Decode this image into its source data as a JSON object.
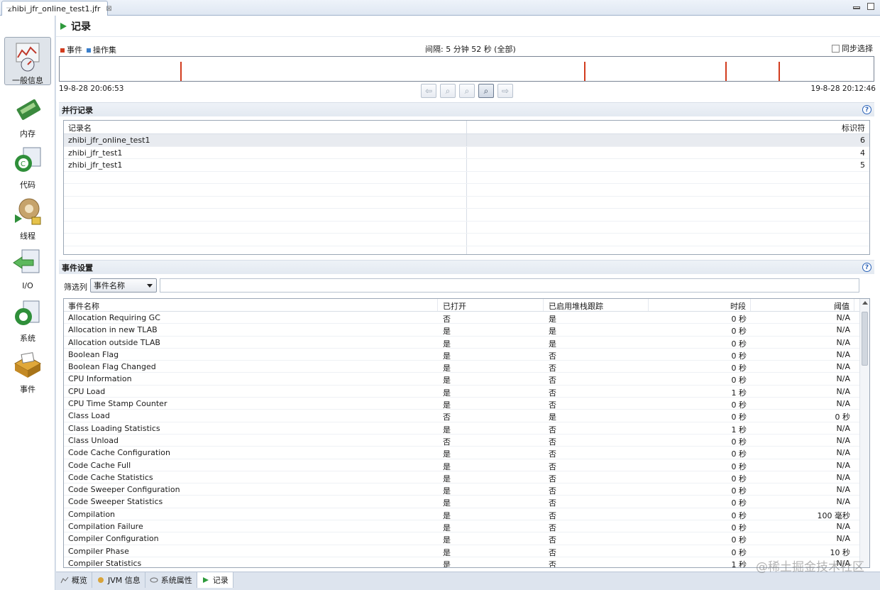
{
  "editor_tab": {
    "title": "zhibi_jfr_online_test1.jfr",
    "close": "⊠"
  },
  "nav": [
    {
      "label": "一般信息",
      "icon": "gauge-icon",
      "active": true
    },
    {
      "label": "内存",
      "icon": "memory-icon"
    },
    {
      "label": "代码",
      "icon": "code-icon"
    },
    {
      "label": "线程",
      "icon": "threads-icon"
    },
    {
      "label": "I/O",
      "icon": "io-icon"
    },
    {
      "label": "系统",
      "icon": "system-icon"
    },
    {
      "label": "事件",
      "icon": "events-icon"
    }
  ],
  "header": {
    "title": "记录"
  },
  "timeline": {
    "legend_events": "事件",
    "legend_opset": "操作集",
    "interval": "间隔: 5 分钟 52 秒 (全部)",
    "sync_select": "同步选择",
    "start": "19-8-28 20:06:53",
    "end": "19-8-28 20:12:46",
    "colors": {
      "events": "#d23c1e",
      "opset": "#3a7fcc"
    }
  },
  "recordings": {
    "section_title": "并行记录",
    "columns": [
      "记录名",
      "标识符"
    ],
    "rows": [
      {
        "name": "zhibi_jfr_online_test1",
        "id": "6"
      },
      {
        "name": "zhibi_jfr_test1",
        "id": "4"
      },
      {
        "name": "zhibi_jfr_test1",
        "id": "5"
      }
    ]
  },
  "event_settings": {
    "section_title": "事件设置",
    "filter_label": "筛选列",
    "filter_value": "事件名称",
    "columns": [
      "事件名称",
      "已打开",
      "已启用堆栈跟踪",
      "时段",
      "阈值"
    ],
    "rows": [
      [
        "Allocation Requiring GC",
        "否",
        "是",
        "0 秒",
        "N/A"
      ],
      [
        "Allocation in new TLAB",
        "是",
        "是",
        "0 秒",
        "N/A"
      ],
      [
        "Allocation outside TLAB",
        "是",
        "是",
        "0 秒",
        "N/A"
      ],
      [
        "Boolean Flag",
        "是",
        "否",
        "0 秒",
        "N/A"
      ],
      [
        "Boolean Flag Changed",
        "是",
        "否",
        "0 秒",
        "N/A"
      ],
      [
        "CPU Information",
        "是",
        "否",
        "0 秒",
        "N/A"
      ],
      [
        "CPU Load",
        "是",
        "否",
        "1 秒",
        "N/A"
      ],
      [
        "CPU Time Stamp Counter",
        "是",
        "否",
        "0 秒",
        "N/A"
      ],
      [
        "Class Load",
        "否",
        "是",
        "0 秒",
        "0 秒"
      ],
      [
        "Class Loading Statistics",
        "是",
        "否",
        "1 秒",
        "N/A"
      ],
      [
        "Class Unload",
        "否",
        "否",
        "0 秒",
        "N/A"
      ],
      [
        "Code Cache Configuration",
        "是",
        "否",
        "0 秒",
        "N/A"
      ],
      [
        "Code Cache Full",
        "是",
        "否",
        "0 秒",
        "N/A"
      ],
      [
        "Code Cache Statistics",
        "是",
        "否",
        "0 秒",
        "N/A"
      ],
      [
        "Code Sweeper Configuration",
        "是",
        "否",
        "0 秒",
        "N/A"
      ],
      [
        "Code Sweeper Statistics",
        "是",
        "否",
        "0 秒",
        "N/A"
      ],
      [
        "Compilation",
        "是",
        "否",
        "0 秒",
        "100 毫秒"
      ],
      [
        "Compilation Failure",
        "是",
        "否",
        "0 秒",
        "N/A"
      ],
      [
        "Compiler Configuration",
        "是",
        "否",
        "0 秒",
        "N/A"
      ],
      [
        "Compiler Phase",
        "是",
        "否",
        "0 秒",
        "10 秒"
      ],
      [
        "Compiler Statistics",
        "是",
        "否",
        "1 秒",
        "N/A"
      ]
    ]
  },
  "bottom_tabs": [
    {
      "label": "概览",
      "icon": "overview-icon"
    },
    {
      "label": "JVM 信息",
      "icon": "jvm-icon"
    },
    {
      "label": "系统属性",
      "icon": "properties-icon"
    },
    {
      "label": "记录",
      "icon": "recording-icon",
      "active": true
    }
  ],
  "watermark": "@稀土掘金技术社区"
}
